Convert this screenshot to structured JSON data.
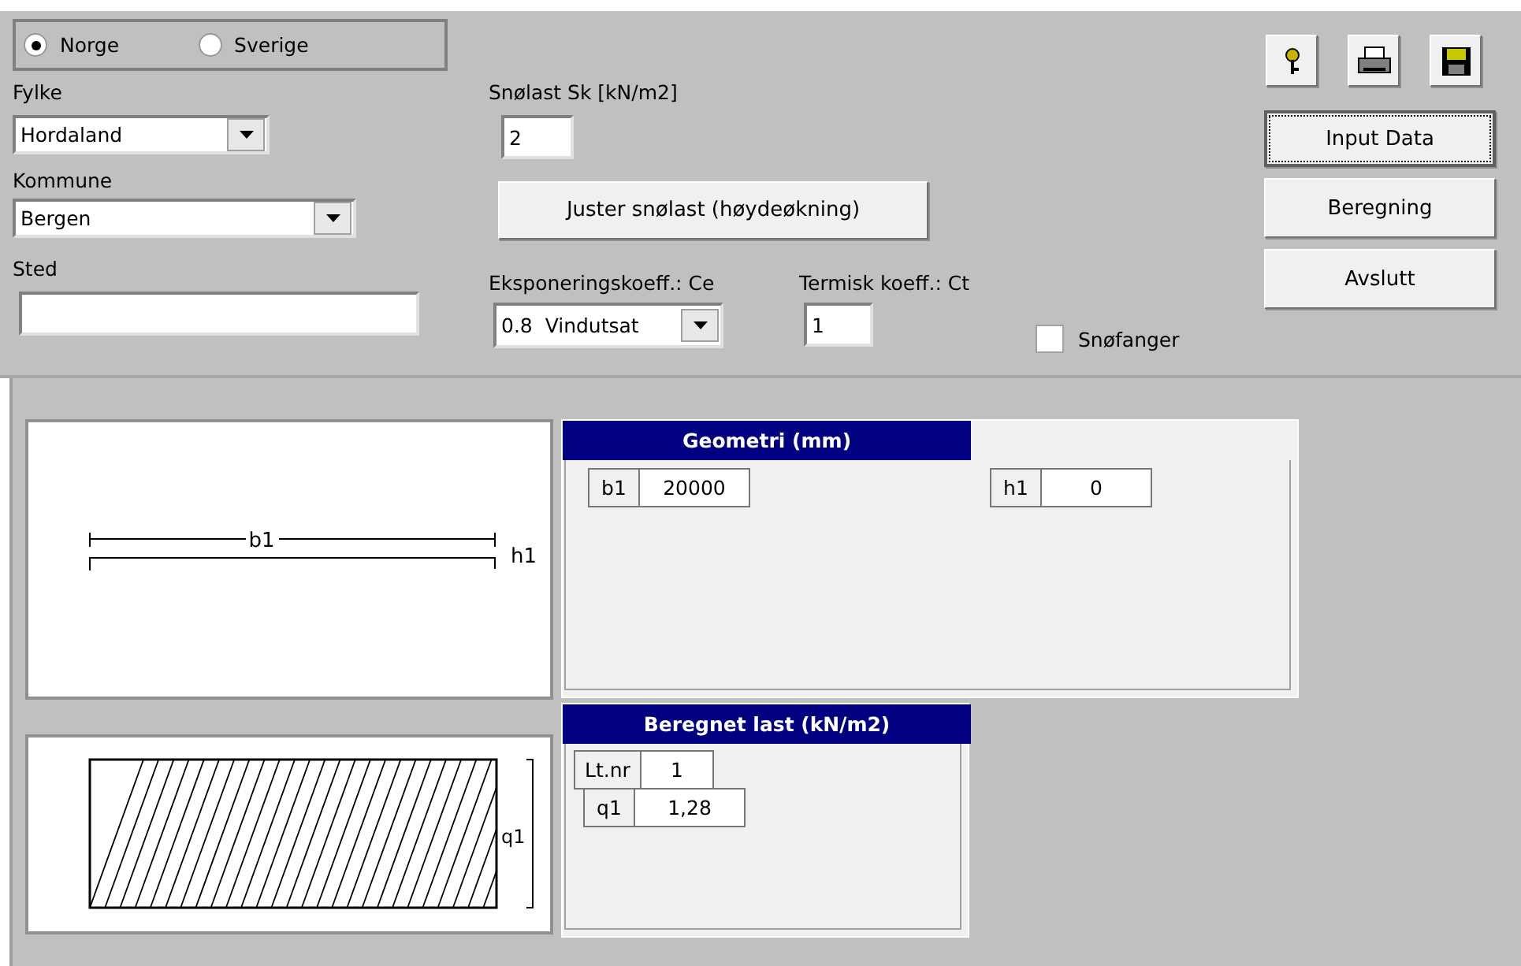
{
  "country_options": [
    {
      "label": "Norge",
      "selected": true
    },
    {
      "label": "Sverige",
      "selected": false
    }
  ],
  "fylke": {
    "label": "Fylke",
    "value": "Hordaland"
  },
  "kommune": {
    "label": "Kommune",
    "value": "Bergen"
  },
  "sted": {
    "label": "Sted"
  },
  "snolast": {
    "label": "Snølast Sk [kN/m2]",
    "value": "2"
  },
  "adjust_button": "Juster snølast (høydeøkning)",
  "exposure": {
    "label": "Eksponeringskoeff.: Ce",
    "value": "0.8  Vindutsat"
  },
  "thermal": {
    "label": "Termisk koeff.: Ct",
    "value": "1"
  },
  "snow_guard": {
    "label": "Snøfanger",
    "checked": false
  },
  "toolbar": [
    {
      "kind": "key"
    },
    {
      "kind": "print"
    },
    {
      "kind": "save"
    }
  ],
  "actions": [
    {
      "label": "Input Data",
      "focused": true
    },
    {
      "label": "Beregning",
      "focused": false
    },
    {
      "label": "Avslutt",
      "focused": false
    }
  ],
  "geometry_drawing": {
    "width_label": "b1",
    "height_label": "h1"
  },
  "load_drawing": {
    "load_label": "q1"
  },
  "geometry": {
    "title": "Geometri (mm)",
    "fields": [
      {
        "label": "b1",
        "value": "20000"
      },
      {
        "label": "h1",
        "value": "0"
      }
    ]
  },
  "result": {
    "title": "Beregnet last (kN/m2)",
    "fields": [
      {
        "label": "Lt.nr",
        "value": "1"
      },
      {
        "label": "q1",
        "value": "1,28"
      }
    ]
  }
}
